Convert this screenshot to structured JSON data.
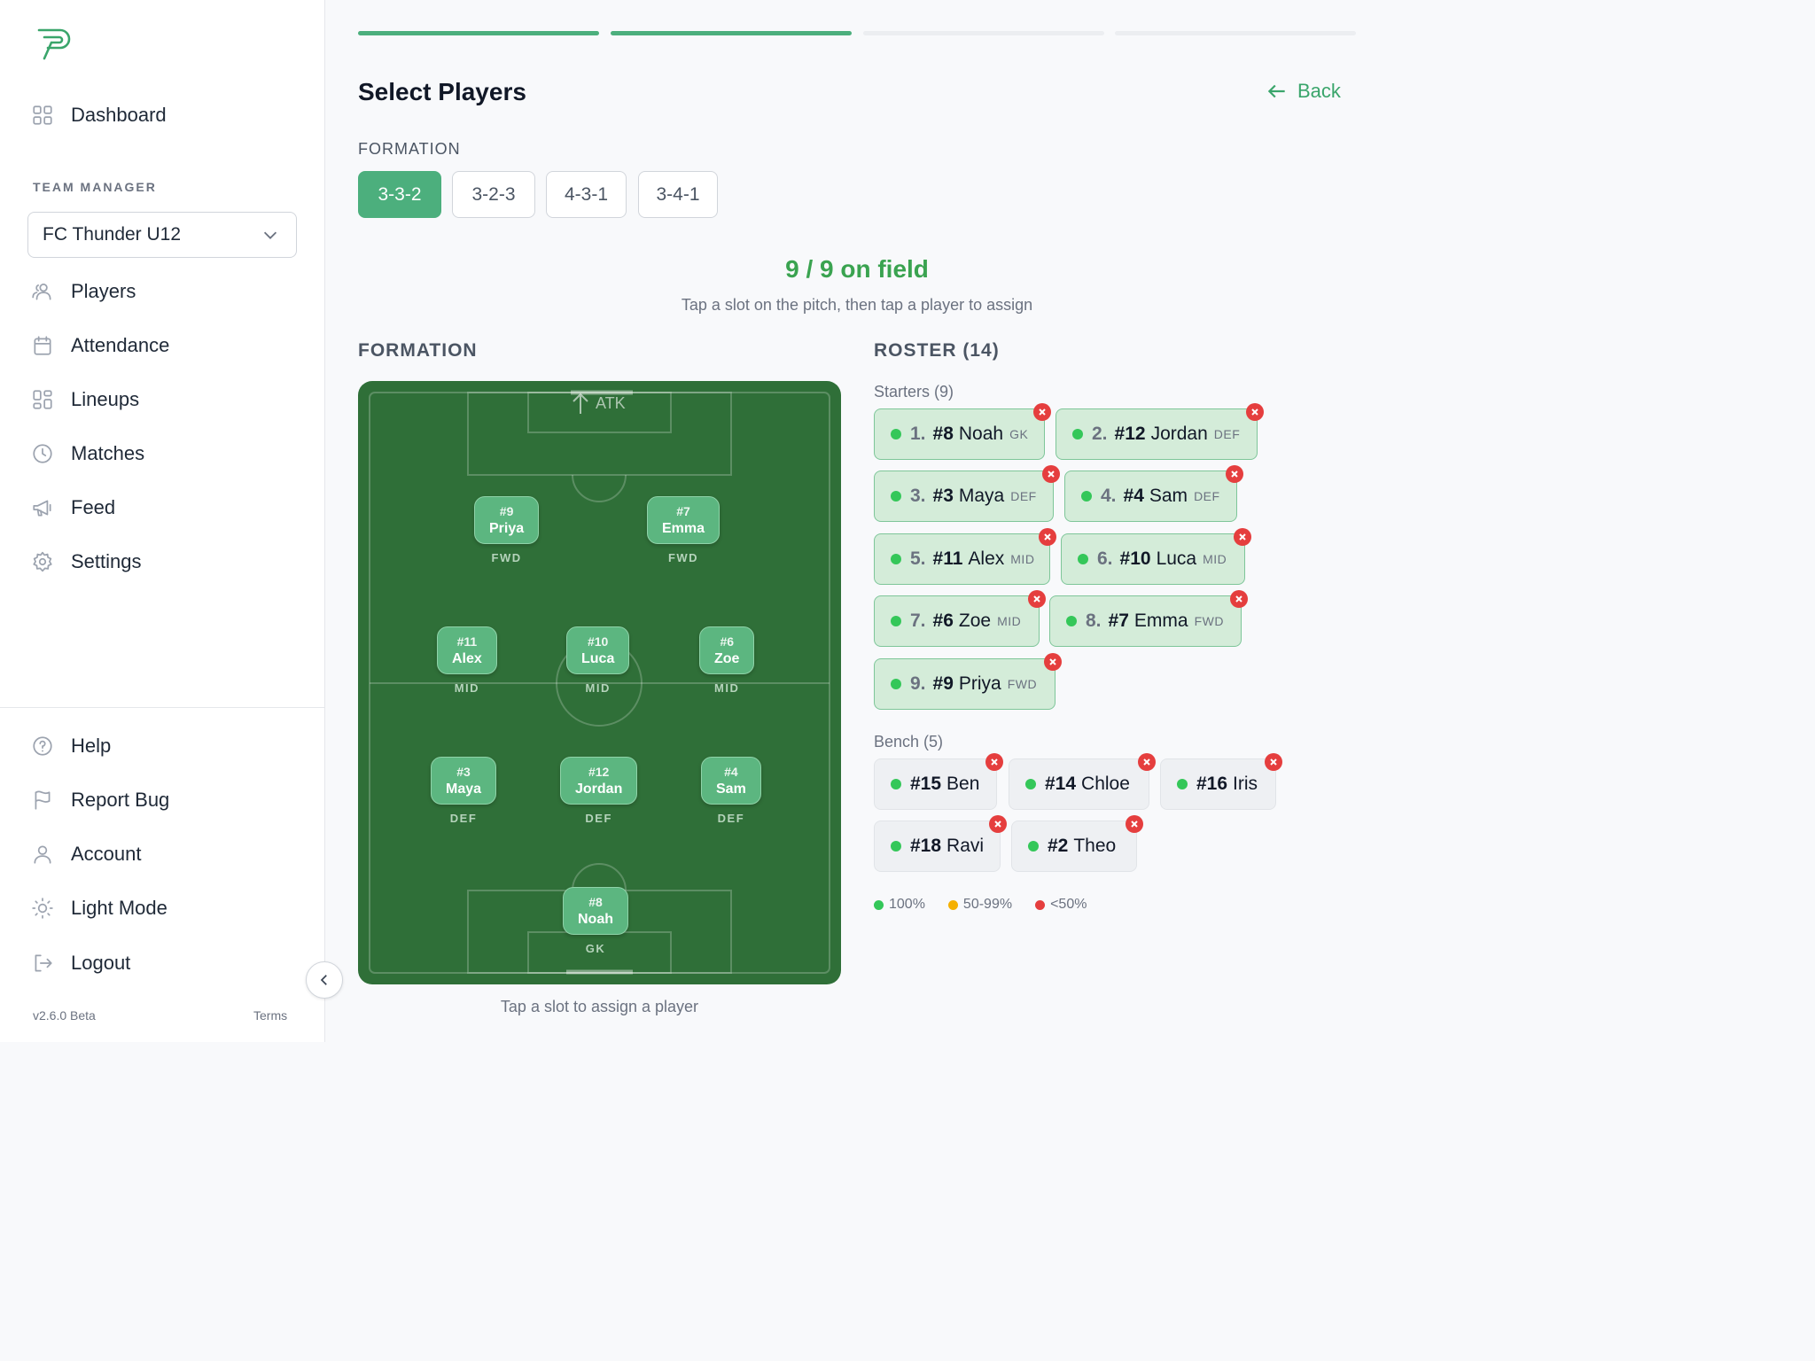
{
  "sidebar": {
    "nav_top": [
      {
        "label": "Dashboard",
        "icon": "dashboard-icon"
      }
    ],
    "section_label": "TEAM MANAGER",
    "team_select": {
      "value": "FC Thunder U12"
    },
    "team_nav": [
      {
        "label": "Players",
        "icon": "players-icon"
      },
      {
        "label": "Attendance",
        "icon": "calendar-icon"
      },
      {
        "label": "Lineups",
        "icon": "lineups-icon"
      },
      {
        "label": "Matches",
        "icon": "clock-icon"
      },
      {
        "label": "Feed",
        "icon": "megaphone-icon"
      },
      {
        "label": "Settings",
        "icon": "gear-icon"
      }
    ],
    "bottom_nav": [
      {
        "label": "Help",
        "icon": "help-icon"
      },
      {
        "label": "Report Bug",
        "icon": "flag-icon"
      },
      {
        "label": "Account",
        "icon": "user-icon"
      },
      {
        "label": "Light Mode",
        "icon": "sun-icon"
      },
      {
        "label": "Logout",
        "icon": "logout-icon"
      }
    ],
    "version": "v2.6.0 Beta",
    "terms": "Terms"
  },
  "wizard": {
    "steps_total": 4,
    "steps_completed": 2
  },
  "header": {
    "title": "Select Players",
    "back_label": "Back"
  },
  "formation_picker": {
    "label": "FORMATION",
    "options": [
      "3-3-2",
      "3-2-3",
      "4-3-1",
      "3-4-1"
    ],
    "selected": "3-3-2"
  },
  "status": {
    "count_text": "9 / 9 on field",
    "hint": "Tap a slot on the pitch, then tap a player to assign"
  },
  "pitch": {
    "title": "FORMATION",
    "attack_label": "ATK",
    "caption": "Tap a slot to assign a player",
    "slots": [
      {
        "number": "#9",
        "name": "Priya",
        "position": "FWD"
      },
      {
        "number": "#7",
        "name": "Emma",
        "position": "FWD"
      },
      {
        "number": "#11",
        "name": "Alex",
        "position": "MID"
      },
      {
        "number": "#10",
        "name": "Luca",
        "position": "MID"
      },
      {
        "number": "#6",
        "name": "Zoe",
        "position": "MID"
      },
      {
        "number": "#3",
        "name": "Maya",
        "position": "DEF"
      },
      {
        "number": "#12",
        "name": "Jordan",
        "position": "DEF"
      },
      {
        "number": "#4",
        "name": "Sam",
        "position": "DEF"
      },
      {
        "number": "#8",
        "name": "Noah",
        "position": "GK"
      }
    ]
  },
  "roster": {
    "title": "ROSTER (14)",
    "starters_label": "Starters (9)",
    "starters": [
      {
        "order": "1.",
        "number": "#8",
        "name": "Noah",
        "position": "GK"
      },
      {
        "order": "2.",
        "number": "#12",
        "name": "Jordan",
        "position": "DEF"
      },
      {
        "order": "3.",
        "number": "#3",
        "name": "Maya",
        "position": "DEF"
      },
      {
        "order": "4.",
        "number": "#4",
        "name": "Sam",
        "position": "DEF"
      },
      {
        "order": "5.",
        "number": "#11",
        "name": "Alex",
        "position": "MID"
      },
      {
        "order": "6.",
        "number": "#10",
        "name": "Luca",
        "position": "MID"
      },
      {
        "order": "7.",
        "number": "#6",
        "name": "Zoe",
        "position": "MID"
      },
      {
        "order": "8.",
        "number": "#7",
        "name": "Emma",
        "position": "FWD"
      },
      {
        "order": "9.",
        "number": "#9",
        "name": "Priya",
        "position": "FWD"
      }
    ],
    "bench_label": "Bench (5)",
    "bench": [
      {
        "number": "#15",
        "name": "Ben"
      },
      {
        "number": "#14",
        "name": "Chloe"
      },
      {
        "number": "#16",
        "name": "Iris"
      },
      {
        "number": "#18",
        "name": "Ravi"
      },
      {
        "number": "#2",
        "name": "Theo"
      }
    ],
    "legend": [
      {
        "label": "100%",
        "color": "#34c759"
      },
      {
        "label": "50-99%",
        "color": "#f5b000"
      },
      {
        "label": "<50%",
        "color": "#e53e3e"
      }
    ]
  }
}
